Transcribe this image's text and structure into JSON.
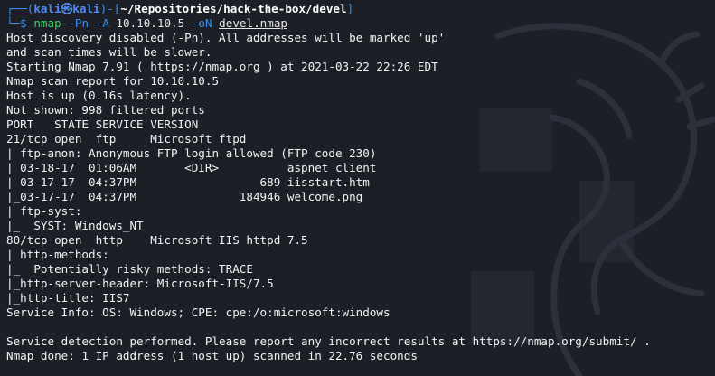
{
  "prompt": {
    "frame_top_left": "┌──(",
    "user": "kali",
    "at_symbol": "㉿",
    "host": "kali",
    "frame_mid": ")-[",
    "path": "~/Repositories/hack-the-box/devel",
    "frame_end": "]",
    "frame_bottom": "└─",
    "dollar": "$ ",
    "command": {
      "program": "nmap",
      "flag_pn": "-Pn",
      "flag_a": "-A",
      "target": "10.10.10.5",
      "flag_on": "-oN",
      "output_file": "devel.nmap"
    }
  },
  "output_lines": [
    "Host discovery disabled (-Pn). All addresses will be marked 'up'",
    "and scan times will be slower.",
    "Starting Nmap 7.91 ( https://nmap.org ) at 2021-03-22 22:26 EDT",
    "Nmap scan report for 10.10.10.5",
    "Host is up (0.16s latency).",
    "Not shown: 998 filtered ports",
    "PORT   STATE SERVICE VERSION",
    "21/tcp open  ftp     Microsoft ftpd",
    "| ftp-anon: Anonymous FTP login allowed (FTP code 230)",
    "| 03-18-17  01:06AM       <DIR>          aspnet_client",
    "| 03-17-17  04:37PM                  689 iisstart.htm",
    "|_03-17-17  04:37PM               184946 welcome.png",
    "| ftp-syst: ",
    "|_  SYST: Windows_NT",
    "80/tcp open  http    Microsoft IIS httpd 7.5",
    "| http-methods: ",
    "|_  Potentially risky methods: TRACE",
    "|_http-server-header: Microsoft-IIS/7.5",
    "|_http-title: IIS7",
    "Service Info: OS: Windows; CPE: cpe:/o:microsoft:windows",
    "",
    "Service detection performed. Please report any incorrect results at https://nmap.org/submit/ .",
    "Nmap done: 1 IP address (1 host up) scanned in 22.76 seconds"
  ],
  "colors": {
    "background": "#1c1f26",
    "prompt_frame": "#3b8eea",
    "command": "#3fcf5e",
    "text": "#f2f2f2"
  },
  "background_icon": "kali-dragon-watermark-icon"
}
